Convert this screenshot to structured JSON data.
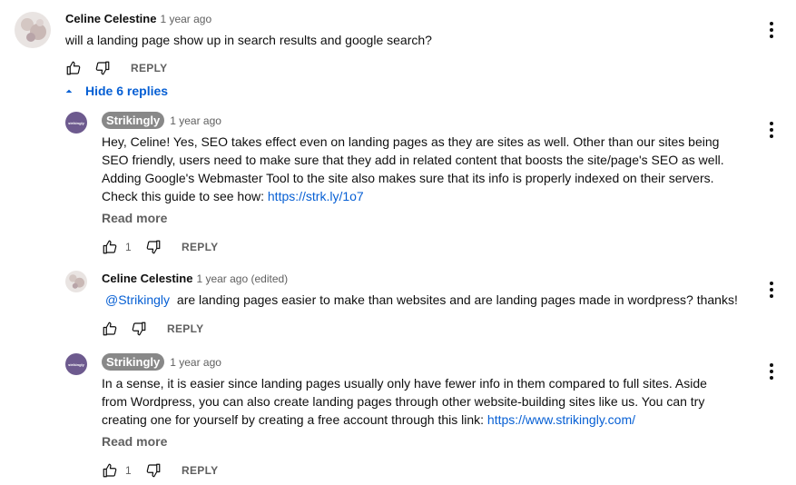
{
  "main_comment": {
    "author": "Celine Celestine",
    "time": "1 year ago",
    "text": "will a landing page show up in search results and google search?",
    "reply_label": "REPLY",
    "like_count": ""
  },
  "replies_toggle": {
    "label": "Hide 6 replies"
  },
  "replies": [
    {
      "author": "Strikingly",
      "avatar_text": "strikingly",
      "time": "1 year ago",
      "text_lines": [
        "Hey, Celine! Yes, SEO takes effect even on landing pages as they are sites as well. Other than our sites being",
        "SEO friendly, users need to make sure that they add in related content that boosts the site/page's SEO as well.",
        "Adding Google's Webmaster Tool to the site also makes sure that its info is properly indexed on their servers.",
        "Check this guide to see how: "
      ],
      "link": "https://strk.ly/1o7",
      "read_more": "Read more",
      "like_count": "1",
      "reply_label": "REPLY"
    },
    {
      "author": "Celine Celestine",
      "time": "1 year ago (edited)",
      "mention": "@Strikingly",
      "text": "are landing pages easier to make than websites and are landing pages made in wordpress? thanks!",
      "like_count": "",
      "reply_label": "REPLY"
    },
    {
      "author": "Strikingly",
      "avatar_text": "strikingly",
      "time": "1 year ago",
      "text_lines": [
        "In a sense, it is easier since landing pages usually only have fewer info in them compared to full sites. Aside",
        "from Wordpress, you can also create landing pages through other website-building sites like us. You can try",
        "creating one for yourself by creating a free account through this link: "
      ],
      "link": "https://www.strikingly.com/",
      "read_more": "Read more",
      "like_count": "1",
      "reply_label": "REPLY"
    }
  ],
  "colors": {
    "link": "#065fd4",
    "badge_bg": "#888888",
    "strikingly_avatar": "#6d5a8e",
    "meta_text": "#606060"
  },
  "icons": [
    "thumb-up-icon",
    "thumb-down-icon",
    "kebab-menu-icon",
    "chevron-up-icon"
  ]
}
